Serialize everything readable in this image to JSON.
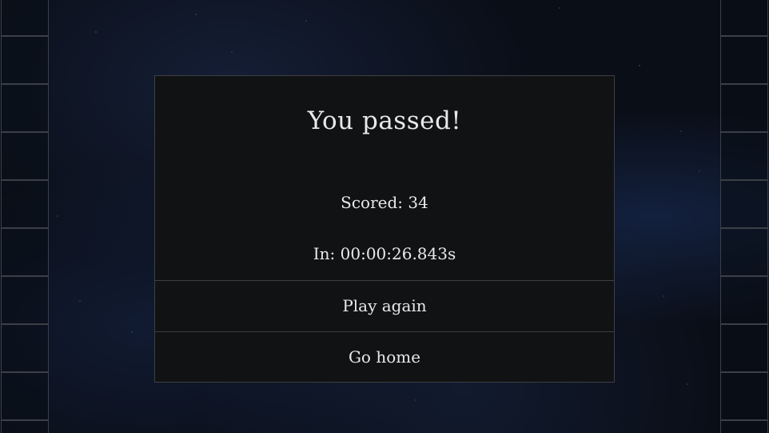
{
  "result": {
    "title": "You passed!",
    "score_text": "Scored: 34",
    "time_text": "In: 00:00:26.843s"
  },
  "actions": {
    "play_again": "Play again",
    "go_home": "Go home"
  },
  "colors": {
    "background": "#0a0e17",
    "dialog_bg": "#111214",
    "border": "#3d3f44",
    "text": "#e9e9ea"
  }
}
